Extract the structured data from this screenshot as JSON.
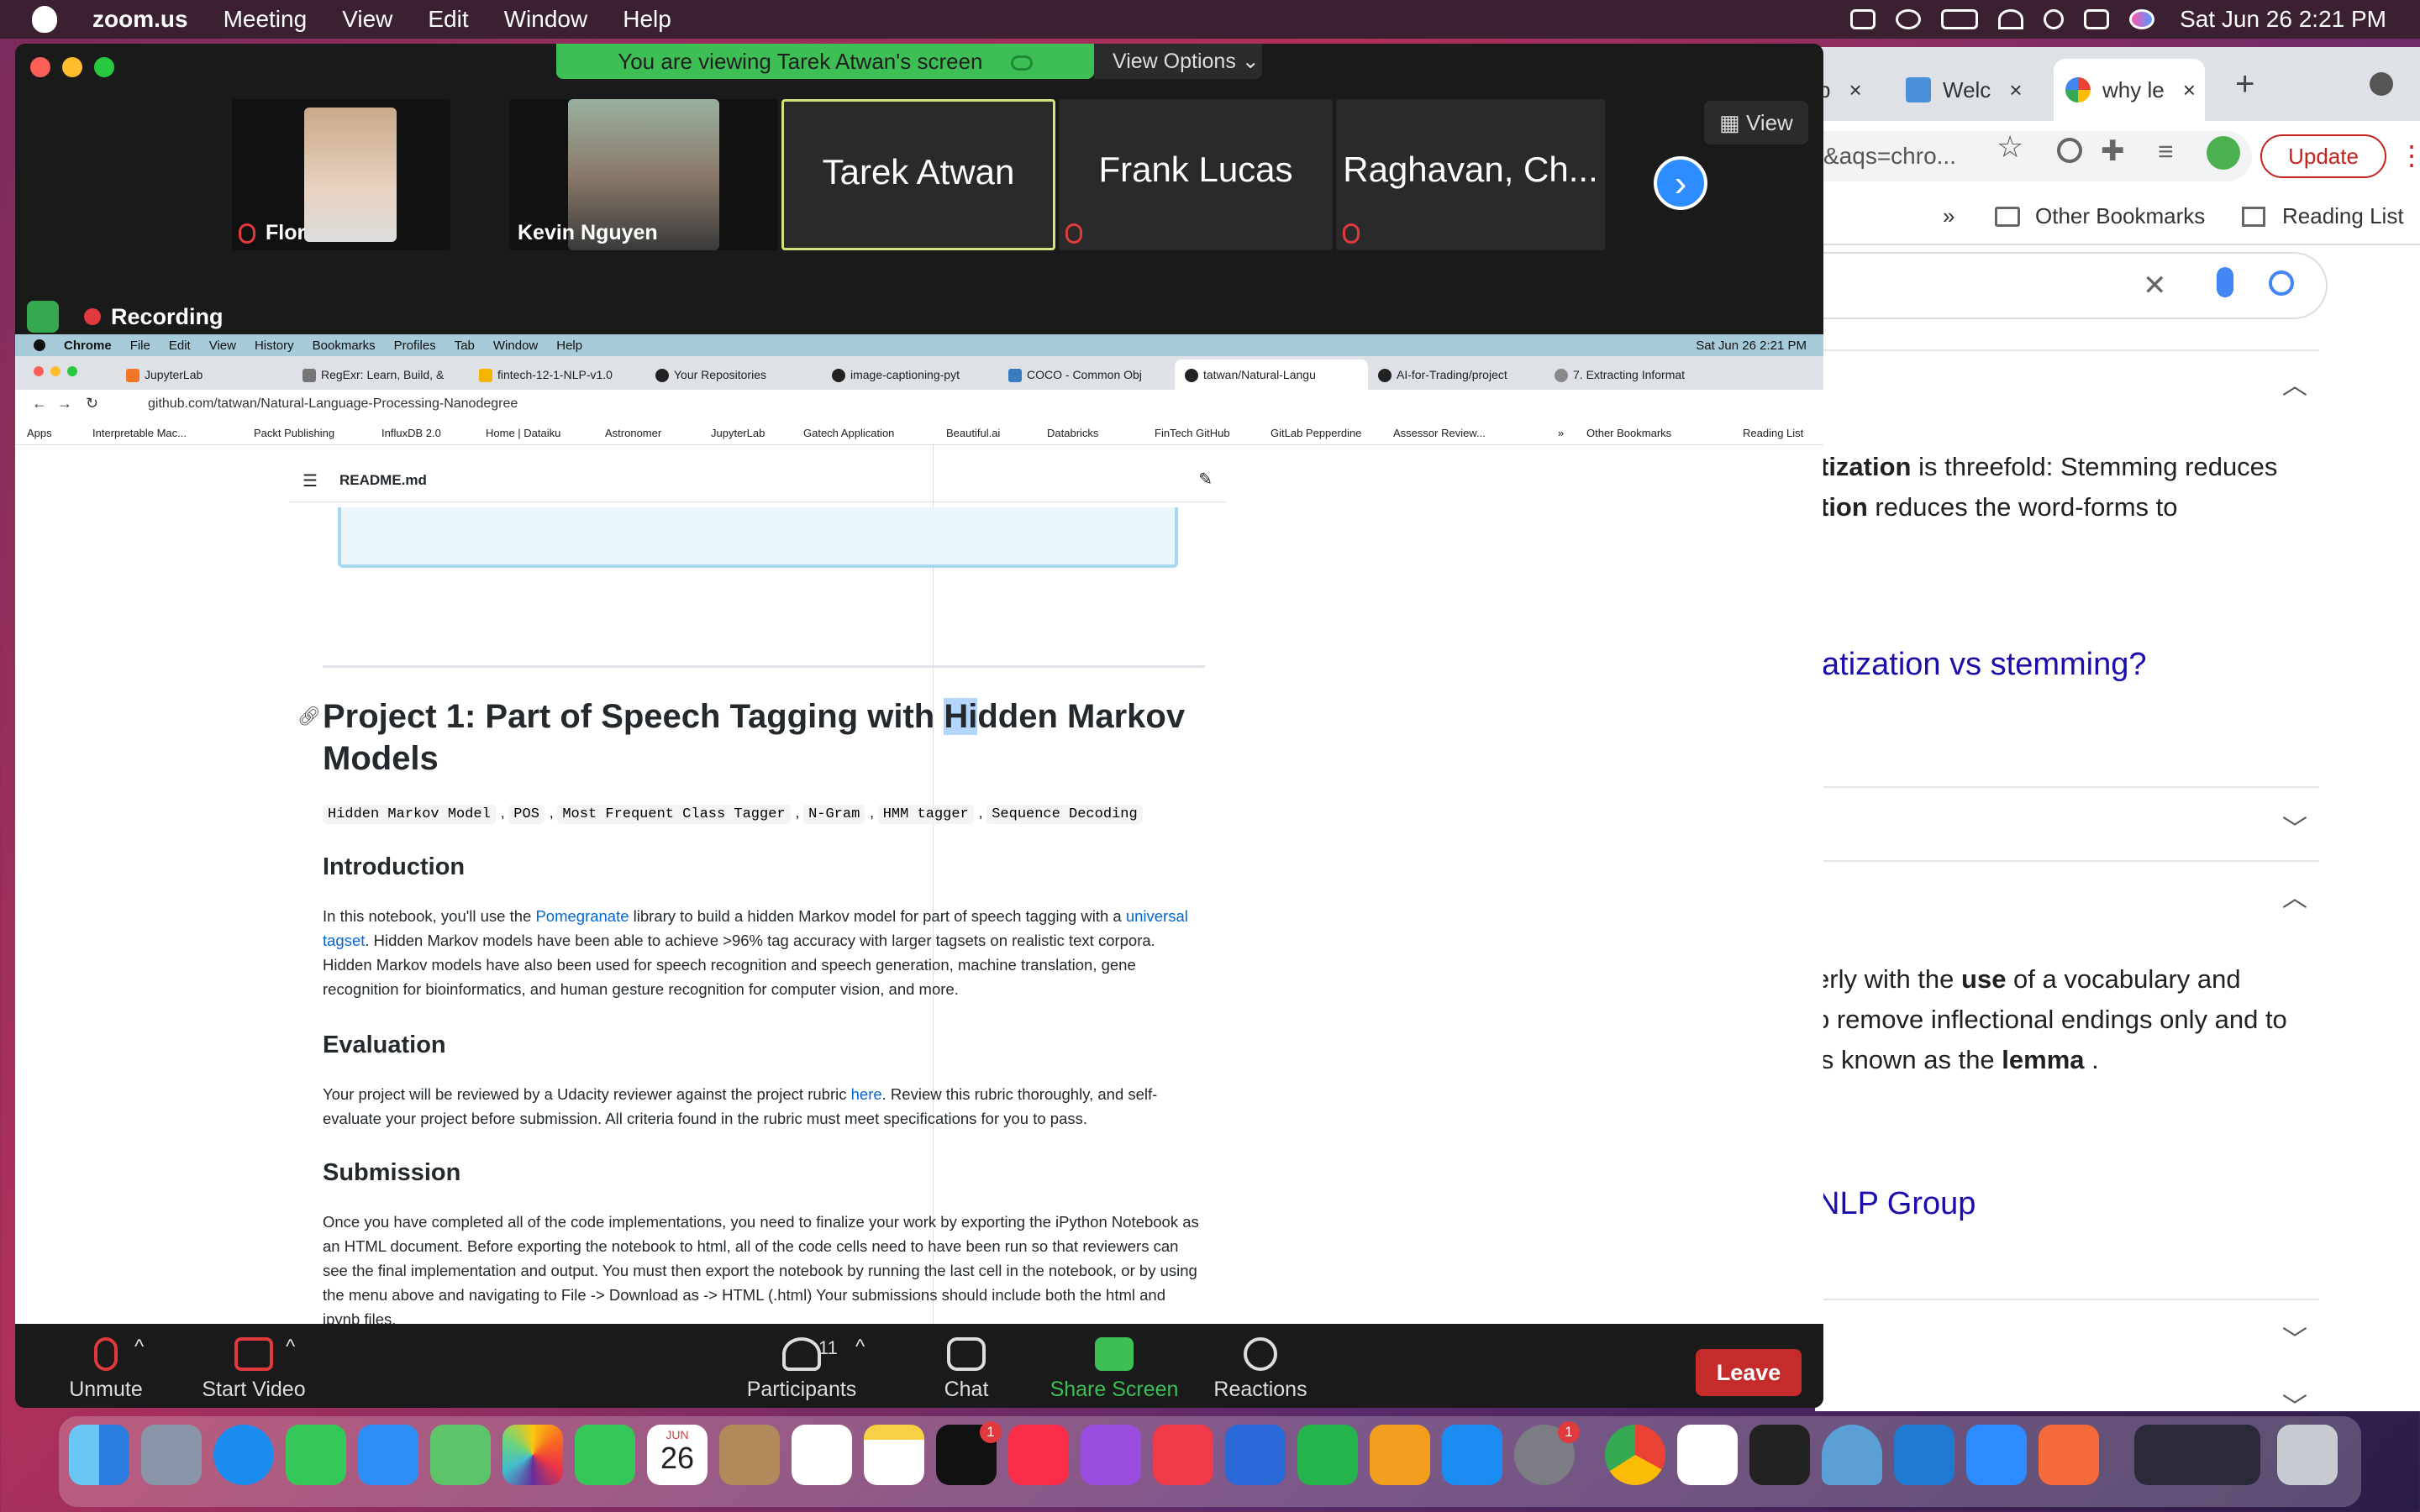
{
  "mac_menubar": {
    "app_name": "zoom.us",
    "items": [
      "Meeting",
      "View",
      "Edit",
      "Window",
      "Help"
    ],
    "clock": "Sat Jun 26  2:21 PM"
  },
  "bg_chrome": {
    "tabs": [
      {
        "label": "p",
        "close": "×"
      },
      {
        "label": "Welc",
        "close": "×"
      },
      {
        "label": "why le",
        "close": "×"
      }
    ],
    "new_tab": "+",
    "url_fragment": "&aqs=chro...",
    "update_label": "Update",
    "bookmark_overflow": "»",
    "other_bookmarks": "Other Bookmarks",
    "reading_list": "Reading List",
    "search_clear": "✕",
    "lines": {
      "l1a": "tization",
      "l1b": " is threefold: Stemming reduces",
      "l2a": "tion",
      "l2b": " reduces the word-forms to",
      "link1": "atization vs stemming?",
      "l3a": "erly with the ",
      "l3b": "use",
      "l3c": " of a vocabulary and",
      "l4": "o remove inflectional endings only and to",
      "l5a": " is known as the ",
      "l5b": "lemma",
      "l5c": " .",
      "link2": "NLP Group"
    }
  },
  "zoom": {
    "banner": "You are viewing Tarek Atwan's screen",
    "view_options": "View Options",
    "view_btn": "View",
    "recording": "Recording",
    "participants": [
      {
        "name": "Flor",
        "muted": true
      },
      {
        "name": "Kevin Nguyen",
        "muted": false
      },
      {
        "name": "Tarek Atwan",
        "muted": false
      },
      {
        "name": "Frank Lucas",
        "muted": true
      },
      {
        "name": "Raghavan, Ch...",
        "muted": true
      }
    ],
    "next_arrow": "›",
    "controls": {
      "unmute": "Unmute",
      "start_video": "Start Video",
      "participants": "Participants",
      "participants_count": "11",
      "chat": "Chat",
      "share_screen": "Share Screen",
      "reactions": "Reactions",
      "leave": "Leave"
    }
  },
  "shared": {
    "menubar": [
      "Chrome",
      "File",
      "Edit",
      "View",
      "History",
      "Bookmarks",
      "Profiles",
      "Tab",
      "Window",
      "Help"
    ],
    "menubar_clock": "Sat Jun 26  2:21 PM",
    "tabs": [
      "JupyterLab",
      "RegExr: Learn, Build, &",
      "fintech-12-1-NLP-v1.0",
      "Your Repositories",
      "image-captioning-pyt",
      "COCO - Common Obj",
      "tatwan/Natural-Langu",
      "AI-for-Trading/project",
      "7. Extracting Informat"
    ],
    "url": "github.com/tatwan/Natural-Language-Processing-Nanodegree",
    "bookmarks": [
      "Apps",
      "Interpretable Mac...",
      "Packt Publishing",
      "InfluxDB 2.0",
      "Home | Dataiku",
      "Astronomer",
      "JupyterLab",
      "Gatech Application",
      "Beautiful.ai",
      "Databricks",
      "FinTech GitHub",
      "GitLab Pepperdine",
      "Assessor Review..."
    ],
    "bm_overflow": "»",
    "bm_other": "Other Bookmarks",
    "bm_reading": "Reading List",
    "readme_title": "README.md",
    "h1_pre": "Project 1: Part of Speech Tagging with ",
    "h1_sel": "Hi",
    "h1_post": "dden Markov Models",
    "tags": [
      "Hidden Markov Model",
      "POS",
      "Most Frequent Class Tagger",
      "N-Gram",
      "HMM tagger",
      "Sequence Decoding"
    ],
    "intro_h": "Introduction",
    "intro_p1": "In this notebook, you'll use the ",
    "intro_link1": "Pomegranate",
    "intro_p2": " library to build a hidden Markov model for part of speech tagging with a ",
    "intro_link2": "universal tagset",
    "intro_p3": ". Hidden Markov models have been able to achieve >96% tag accuracy with larger tagsets on realistic text corpora. Hidden Markov models have also been used for speech recognition and speech generation, machine translation, gene recognition for bioinformatics, and human gesture recognition for computer vision, and more.",
    "eval_h": "Evaluation",
    "eval_p1": "Your project will be reviewed by a Udacity reviewer against the project rubric ",
    "eval_link": "here",
    "eval_p2": ". Review this rubric thoroughly, and self-evaluate your project before submission. All criteria found in the rubric must meet specifications for you to pass.",
    "sub_h": "Submission",
    "sub_p": "Once you have completed all of the code implementations, you need to finalize your work by exporting the iPython Notebook as an HTML document. Before exporting the notebook to html, all of the code cells need to have been run so that reviewers can see the final implementation and output. You must then export the notebook by running the last cell in the notebook, or by using the menu above and navigating to File -> Download as -> HTML (.html) Your submissions should include both the html and ipynb files."
  },
  "dock": {
    "calendar_month": "JUN",
    "calendar_day": "26",
    "badges": {
      "tv": "1",
      "settings": "1"
    },
    "apps": [
      "finder",
      "launchpad",
      "safari",
      "messages",
      "mail",
      "maps",
      "photos",
      "facetime",
      "calendar",
      "contacts",
      "reminders",
      "notes",
      "tv",
      "music",
      "podcasts",
      "news",
      "keynote",
      "numbers",
      "pages",
      "app-store",
      "system-preferences",
      "chrome",
      "slack",
      "terminal",
      "vscode",
      "zoom",
      "pencil",
      "downloads",
      "trash"
    ]
  },
  "colors": {
    "zoom_green": "#3dbf55",
    "zoom_blue": "#2d8cff",
    "leave_red": "#c62b2b",
    "link_blue": "#0366d6"
  }
}
